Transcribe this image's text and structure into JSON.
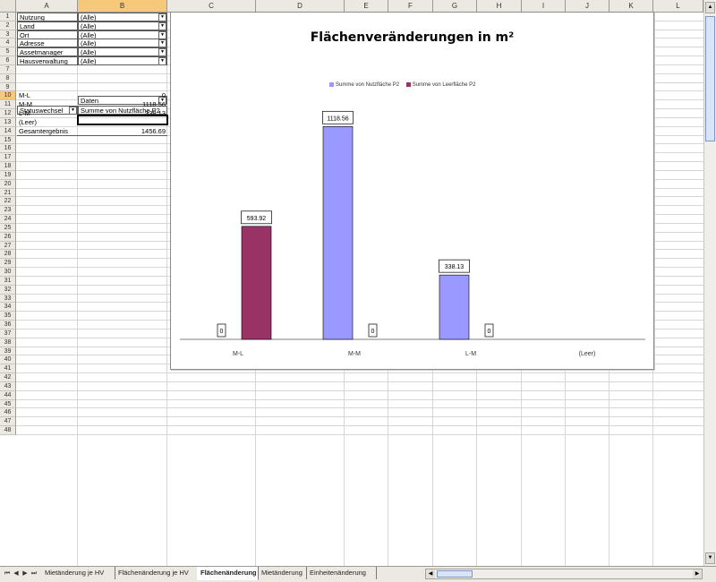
{
  "columns": [
    "A",
    "B",
    "C",
    "D",
    "E",
    "F",
    "G",
    "H",
    "I",
    "J",
    "K",
    "L"
  ],
  "rows": [
    "1",
    "2",
    "3",
    "4",
    "5",
    "6",
    "7",
    "8",
    "9",
    "10",
    "11",
    "12",
    "13",
    "14",
    "15",
    "16",
    "17",
    "18",
    "19",
    "20",
    "21",
    "22",
    "23",
    "24",
    "25",
    "26",
    "27",
    "28",
    "29",
    "30",
    "31",
    "32",
    "33",
    "34",
    "35",
    "36",
    "37",
    "38",
    "39",
    "40",
    "41",
    "42",
    "43",
    "44",
    "45",
    "46",
    "47",
    "48"
  ],
  "filters": [
    {
      "label": "Nutzung",
      "value": "(Alle)"
    },
    {
      "label": "Land",
      "value": "(Alle)"
    },
    {
      "label": "Ort",
      "value": "(Alle)"
    },
    {
      "label": "Adresse",
      "value": "(Alle)"
    },
    {
      "label": "Assetmanager",
      "value": "(Alle)"
    },
    {
      "label": "Hausverwaltung",
      "value": "(Alle)"
    }
  ],
  "pivot": {
    "data_label": "Daten",
    "row_field": "Statuswechsel",
    "value_header": "Summe von Nutzfläche P2",
    "rows": [
      {
        "label": "M-L",
        "value": "0"
      },
      {
        "label": "M-M",
        "value": "1118.56"
      },
      {
        "label": "L-M",
        "value": "338.13"
      },
      {
        "label": "(Leer)",
        "value": ""
      },
      {
        "label": "Gesamtergebnis",
        "value": "1456.69"
      }
    ]
  },
  "chart_data": {
    "type": "bar",
    "title": "Flächenveränderungen in m²",
    "categories": [
      "M-L",
      "M-M",
      "L-M",
      "(Leer)"
    ],
    "series": [
      {
        "name": "Summe von Nutzfläche P2",
        "color": "#9999ff",
        "values": [
          0,
          1118.56,
          338.13,
          null
        ],
        "labels": [
          "0",
          "1118.56",
          "338.13",
          ""
        ]
      },
      {
        "name": "Summe von Leerfläche P2",
        "color": "#993366",
        "values": [
          593.92,
          0,
          0,
          null
        ],
        "labels": [
          "593.92",
          "0",
          "0",
          ""
        ]
      }
    ],
    "ylim": [
      0,
      1200
    ],
    "legend_position": "top",
    "grid": false
  },
  "tabs": [
    {
      "label": "Mietänderung je HV",
      "active": false
    },
    {
      "label": "Flächenänderung je HV",
      "active": false
    },
    {
      "label": "Flächenänderung",
      "active": true
    },
    {
      "label": "Mietänderung",
      "active": false
    },
    {
      "label": "Einheitenänderung",
      "active": false
    }
  ],
  "nav": {
    "first": "⏮",
    "prev": "◀",
    "next": "▶",
    "last": "⏭"
  },
  "dropdown_glyph": "▼"
}
